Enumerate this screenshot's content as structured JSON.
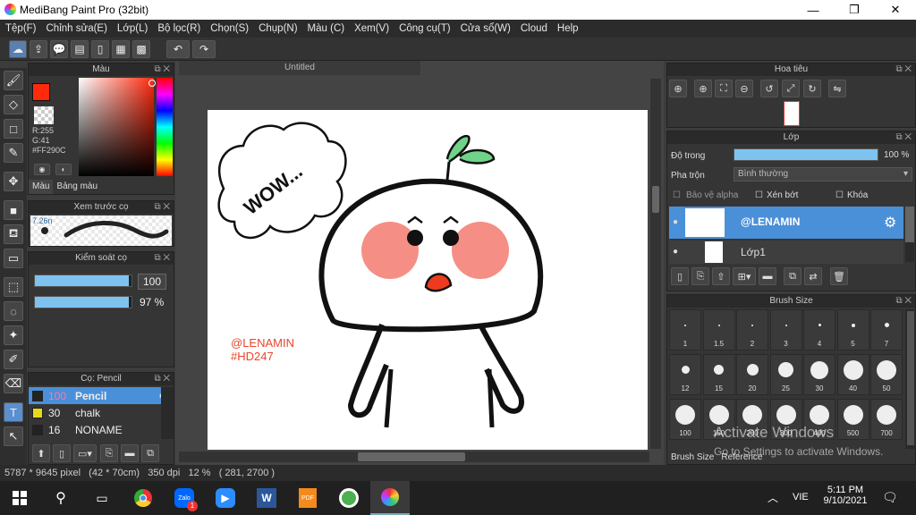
{
  "app": {
    "title": "MediBang Paint Pro (32bit)"
  },
  "window": {
    "minimize": "—",
    "maximize": "❐",
    "close": "✕"
  },
  "menu": [
    "Tệp(F)",
    "Chỉnh sửa(E)",
    "Lớp(L)",
    "Bộ lọc(R)",
    "Chọn(S)",
    "Chụp(N)",
    "Màu (C)",
    "Xem(V)",
    "Công cụ(T)",
    "Cửa sổ(W)",
    "Cloud",
    "Help"
  ],
  "color_panel": {
    "title": "Màu",
    "r": "R:255",
    "g": "G:41",
    "hex": "#FF290C",
    "tab_color": "Màu",
    "tab_palette": "Bảng màu",
    "current_color": "#ff290c"
  },
  "brush_preview": {
    "title": "Xem trước cọ",
    "size": "7.26n"
  },
  "brush_control": {
    "title": "Kiểm soát cọ",
    "size_value": "100",
    "opacity_value": "97 %",
    "opacity": 0.97,
    "size_fill": 0.97
  },
  "brush_list": {
    "title": "Cọ: Pencil",
    "items": [
      {
        "size": "100",
        "name": "Pencil",
        "color": "#222"
      },
      {
        "size": "30",
        "name": "chalk",
        "color": "#e8d81a"
      },
      {
        "size": "16",
        "name": "NONAME",
        "color": "#222"
      }
    ]
  },
  "document": {
    "tab": "Untitled",
    "watermark_line1": "@LENAMIN",
    "watermark_line2": "#HD247",
    "speech": "WOW..."
  },
  "navigator": {
    "title": "Hoa tiêu"
  },
  "layer_panel": {
    "title": "Lớp",
    "opacity_label": "Độ trong",
    "opacity_value": "100 %",
    "opacity": 1.0,
    "blend_label": "Pha trộn",
    "blend_value": "Bình thường",
    "protect_alpha": "Bảo vệ alpha",
    "clip": "Xén bớt",
    "lock": "Khóa",
    "layers": [
      {
        "name": "@LENAMIN",
        "selected": true
      },
      {
        "name": "Lớp1",
        "selected": false
      }
    ]
  },
  "brush_size": {
    "title": "Brush Size",
    "sizes": [
      "1",
      "1.5",
      "2",
      "3",
      "4",
      "5",
      "7",
      "12",
      "15",
      "20",
      "25",
      "30",
      "40",
      "50",
      "100",
      "150",
      "200",
      "300",
      "400",
      "500",
      "700"
    ],
    "tab1": "Brush Size",
    "tab2": "Reference"
  },
  "activation": {
    "line1": "Activate Windows",
    "line2": "Go to Settings to activate Windows."
  },
  "status": {
    "text": "5787 * 9645 pixel   (42 * 70cm)   350 dpi   12 %   ( 281, 2700 )"
  },
  "taskbar": {
    "lang": "VIE",
    "time": "5:11 PM",
    "date": "9/10/2021",
    "zalo_badge": "1"
  }
}
